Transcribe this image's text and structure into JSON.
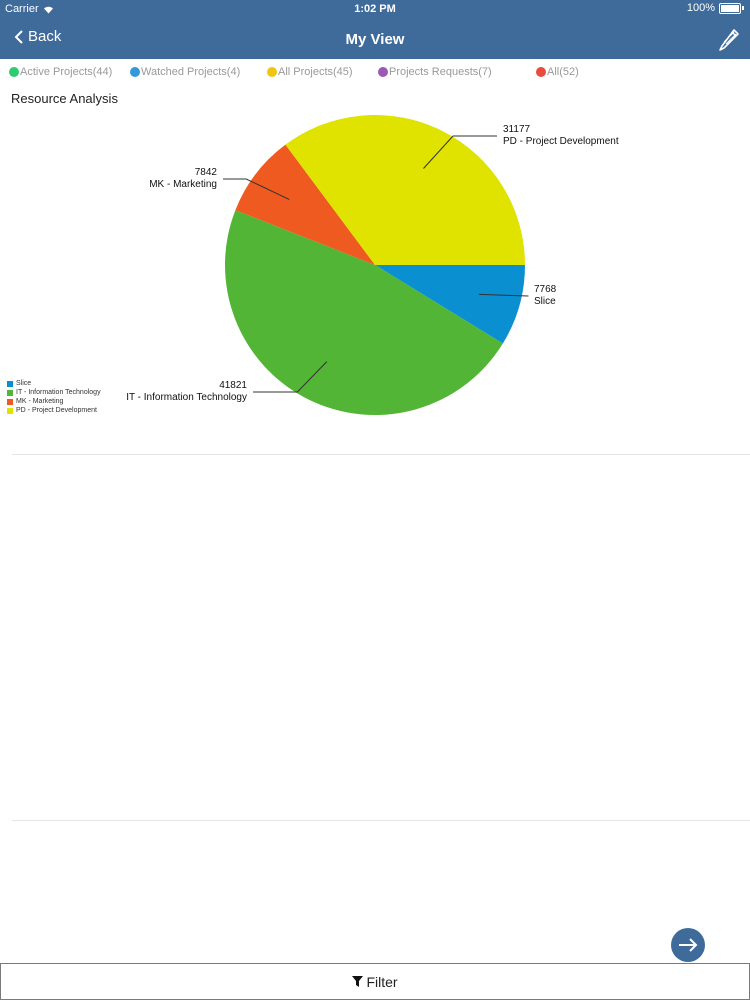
{
  "status_bar": {
    "carrier": "Carrier",
    "time": "1:02 PM",
    "battery": "100%"
  },
  "nav": {
    "back_label": "Back",
    "title": "My View"
  },
  "tabs": [
    {
      "label": "Active Projects(44)",
      "color": "#2ecc71"
    },
    {
      "label": "Watched Projects(4)",
      "color": "#3498db"
    },
    {
      "label": "All Projects(45)",
      "color": "#f1c40f"
    },
    {
      "label": "Projects Requests(7)",
      "color": "#9b59b6"
    },
    {
      "label": "All(52)",
      "color": "#e74c3c"
    }
  ],
  "section": {
    "title": "Resource Analysis"
  },
  "chart_data": {
    "type": "pie",
    "title": "",
    "slices": [
      {
        "name": "Slice",
        "value": 7768,
        "color": "#0a8fd0"
      },
      {
        "name": "IT - Information Technology",
        "value": 41821,
        "color": "#52b535"
      },
      {
        "name": "MK - Marketing",
        "value": 7842,
        "color": "#ee5a1f"
      },
      {
        "name": "PD - Project Development",
        "value": 31177,
        "color": "#e0e300"
      }
    ],
    "legend_position": "bottom-left"
  },
  "filter": {
    "label": "Filter"
  }
}
